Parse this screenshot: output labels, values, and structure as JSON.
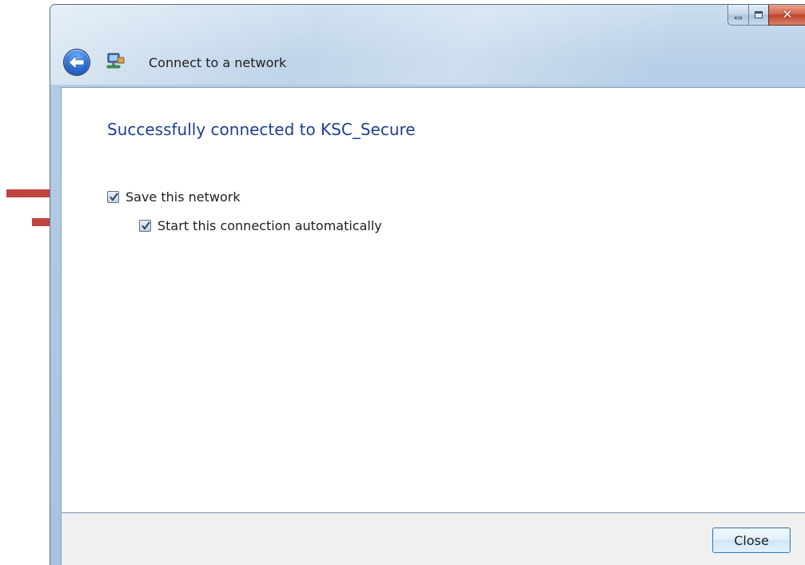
{
  "window": {
    "title": "Connect to a network",
    "controls": {
      "minimize": "minimize",
      "maximize": "maximize",
      "close": "close"
    }
  },
  "content": {
    "heading": "Successfully connected to KSC_Secure",
    "options": [
      {
        "label": "Save this network",
        "checked": true
      },
      {
        "label": "Start this connection automatically",
        "checked": true
      }
    ]
  },
  "footer": {
    "close_label": "Close"
  },
  "icons": {
    "back": "back-arrow-icon",
    "network": "network-connection-icon",
    "annotation": "red-arrow-icon"
  },
  "colors": {
    "heading": "#1e3f93",
    "annotation_arrow": "#c0453f",
    "close_caption": "#c0432b"
  }
}
